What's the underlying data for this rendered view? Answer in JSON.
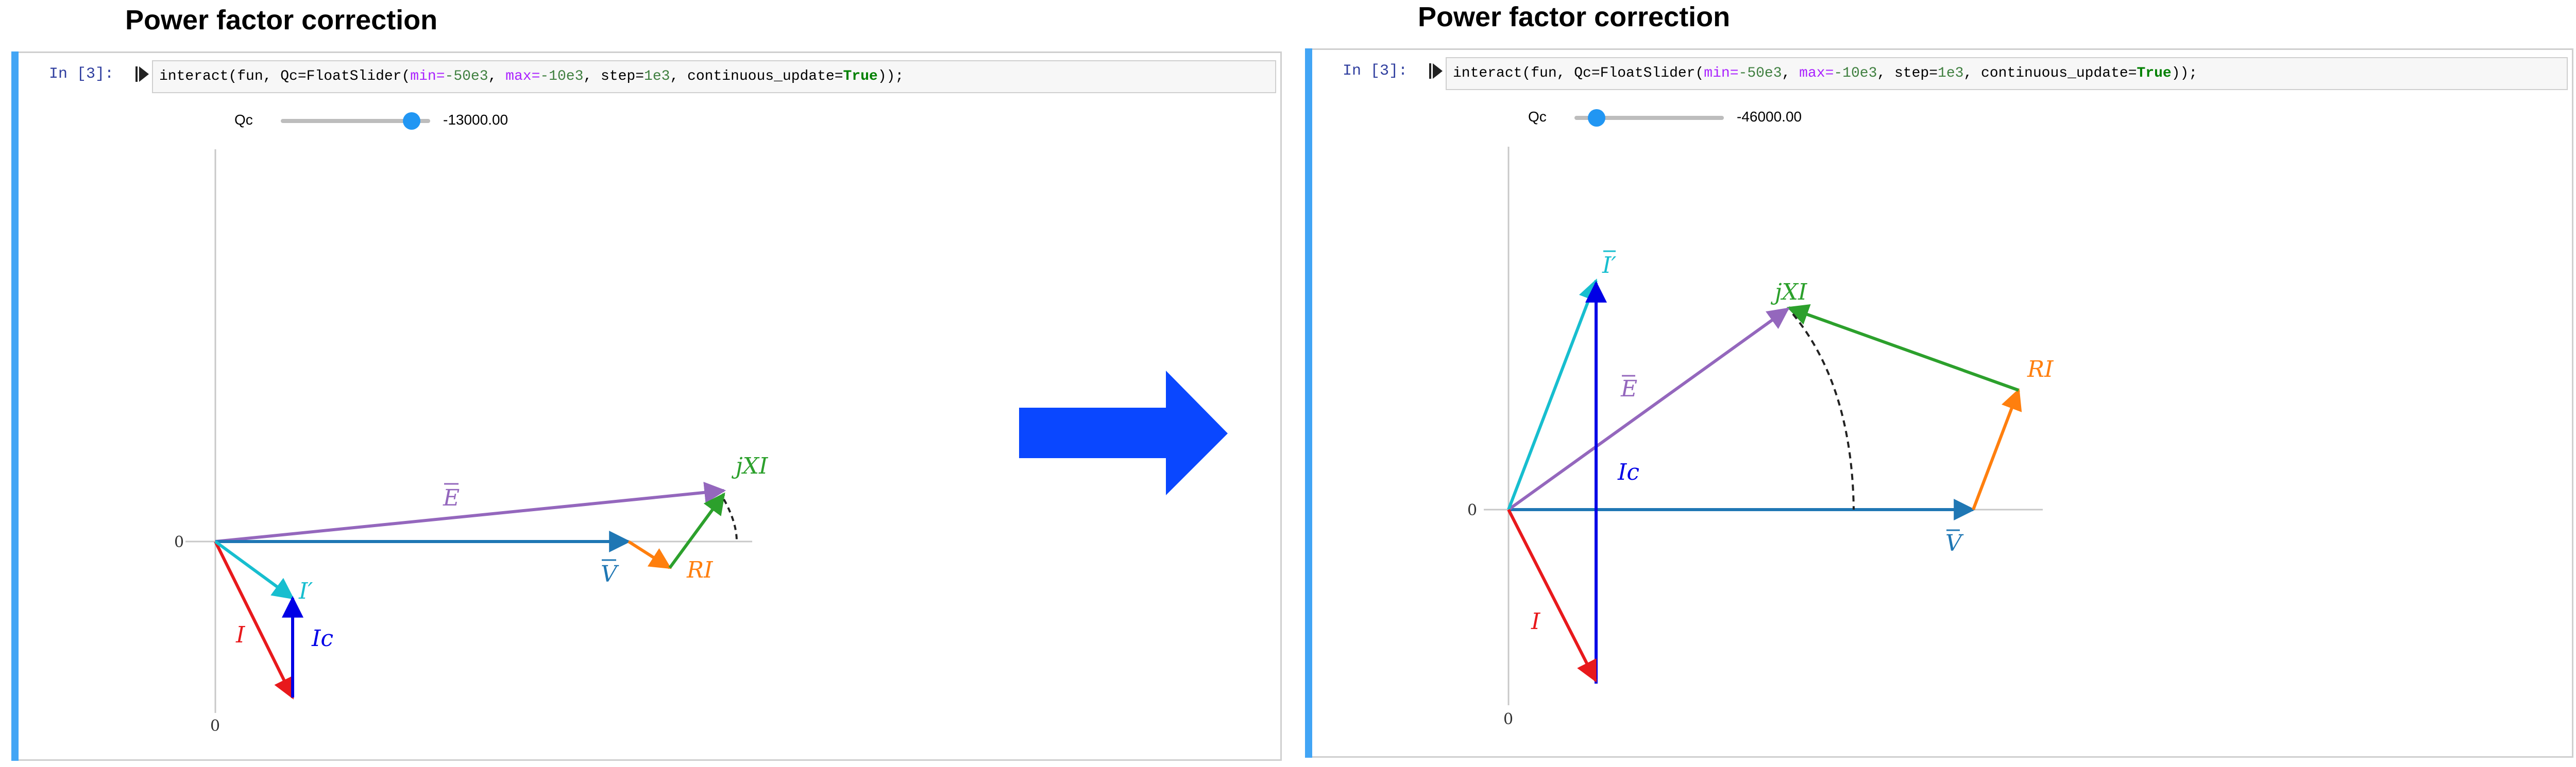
{
  "panels": [
    {
      "title": "Power factor correction",
      "prompt": "In [3]:",
      "code": {
        "prefix": "interact(fun, Qc=FloatSlider(",
        "kw_min": "min",
        "eq1": "=",
        "num_min": "-50e3",
        "sep1": ", ",
        "kw_max": "max",
        "eq2": "=",
        "num_max": "-10e3",
        "sep2": ", step=",
        "num_step": "1e3",
        "sep3": ", continuous_update=",
        "kw_true": "True",
        "suffix": "));"
      },
      "slider": {
        "label": "Qc",
        "value_text": "-13000.00",
        "value": -13000,
        "min": -50000,
        "max": -10000
      },
      "plot": {
        "origin_label": "0",
        "bottom_label": "0",
        "labels": {
          "E": "E",
          "V": "V",
          "RI": "RI",
          "jXI": "jXI",
          "I": "I",
          "Ip": "I′",
          "Ic": "Ic"
        }
      }
    },
    {
      "title": "Power factor correction",
      "prompt": "In [3]:",
      "code": {
        "prefix": "interact(fun, Qc=FloatSlider(",
        "kw_min": "min",
        "eq1": "=",
        "num_min": "-50e3",
        "sep1": ", ",
        "kw_max": "max",
        "eq2": "=",
        "num_max": "-10e3",
        "sep2": ", step=",
        "num_step": "1e3",
        "sep3": ", continuous_update=",
        "kw_true": "True",
        "suffix": "));"
      },
      "slider": {
        "label": "Qc",
        "value_text": "-46000.00",
        "value": -46000,
        "min": -50000,
        "max": -10000
      },
      "plot": {
        "origin_label": "0",
        "bottom_label": "0",
        "labels": {
          "E": "E",
          "V": "V",
          "RI": "RI",
          "jXI": "jXI",
          "I": "I",
          "Ip": "I′",
          "Ic": "Ic"
        }
      }
    }
  ],
  "colors": {
    "V": "#1f77b4",
    "E": "#9467bd",
    "RI": "#ff7f0e",
    "jXI": "#2ca02c",
    "I": "#e8191c",
    "Ip": "#17becf",
    "Ic": "#0000e6",
    "transition_arrow": "#0a47ff",
    "accent": "#42a5f5"
  }
}
